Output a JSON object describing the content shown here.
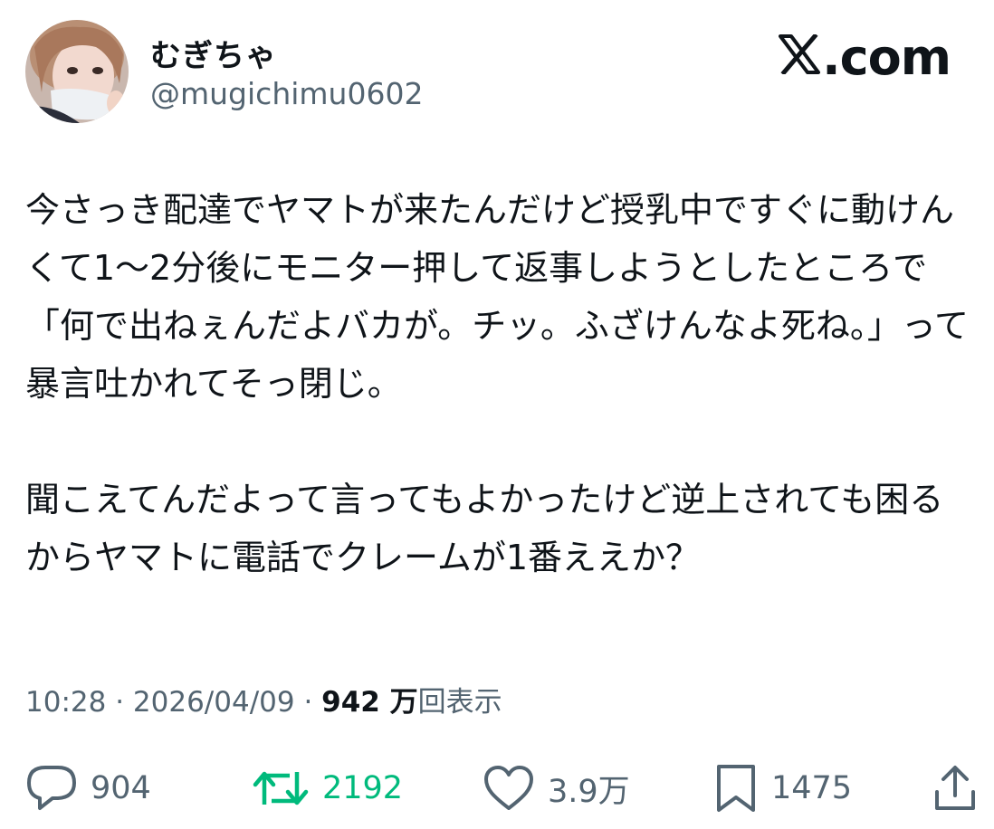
{
  "author": {
    "display_name": "むぎちゃ",
    "handle": "@mugichimu0602"
  },
  "brand": {
    "domain": ".com",
    "icon": "x-logo-icon"
  },
  "tweet": {
    "paragraphs": [
      "今さっき配達でヤマトが来たんだけど授乳中ですぐに動けんくて1〜2分後にモニター押して返事しようとしたところで「何で出ねぇんだよバカが。チッ。ふざけんなよ死ね。」って暴言吐かれてそっ閉じ。",
      "聞こえてんだよって言ってもよかったけど逆上されても困るからヤマトに電話でクレームが1番ええか？"
    ]
  },
  "meta": {
    "time": "10:28",
    "separator": " · ",
    "date": "2026/04/09",
    "views_count": "942 万",
    "views_label": "回表示"
  },
  "actions": {
    "replies": "904",
    "retweets": "2192",
    "likes": "3.9万",
    "bookmarks": "1475",
    "retweet_color": "#00ba7c",
    "icon_color": "#536471"
  }
}
